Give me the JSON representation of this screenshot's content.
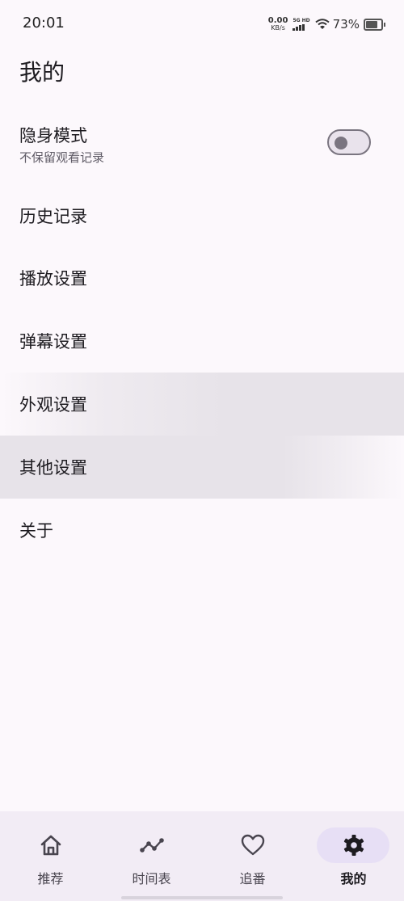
{
  "status_bar": {
    "time": "20:01",
    "net_speed_value": "0.00",
    "net_speed_unit": "KB/s",
    "signal_label": "5G HD",
    "battery_text": "73%",
    "battery_level": 0.73
  },
  "page_title": "我的",
  "incognito": {
    "label": "隐身模式",
    "description": "不保留观看记录",
    "enabled": false
  },
  "menu_items": [
    {
      "label": "历史记录"
    },
    {
      "label": "播放设置"
    },
    {
      "label": "弹幕设置"
    },
    {
      "label": "外观设置"
    },
    {
      "label": "其他设置"
    },
    {
      "label": "关于"
    }
  ],
  "bottom_nav": {
    "items": [
      {
        "label": "推荐",
        "icon": "home-icon"
      },
      {
        "label": "时间表",
        "icon": "timeline-icon"
      },
      {
        "label": "追番",
        "icon": "heart-icon"
      },
      {
        "label": "我的",
        "icon": "gear-icon",
        "active": true
      }
    ]
  },
  "colors": {
    "background": "#fcf8fc",
    "nav_background": "#f2ecf5",
    "active_pill": "#e7dff5"
  }
}
